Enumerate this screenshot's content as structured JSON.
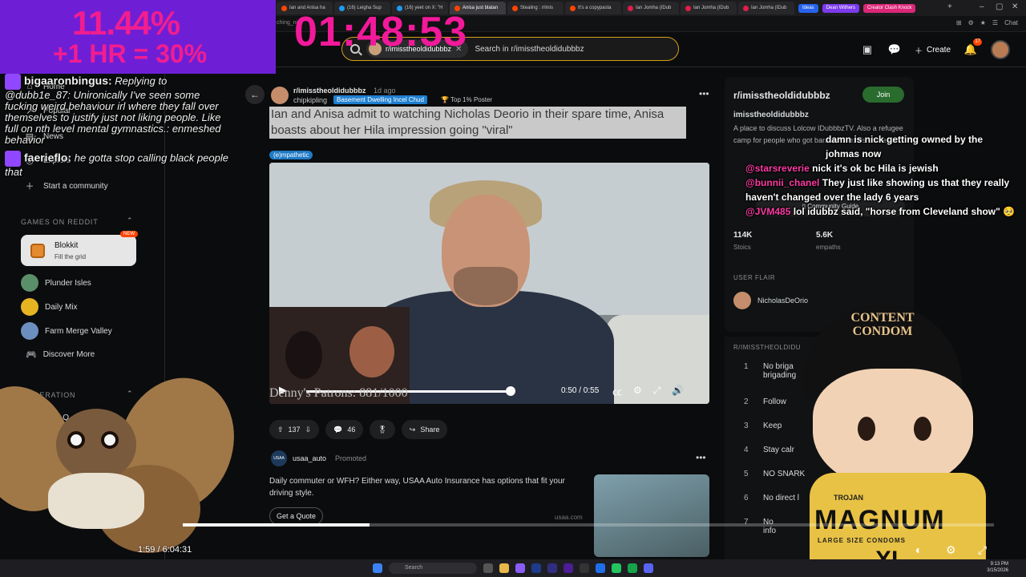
{
  "browser": {
    "tabs": [
      "Ian and Anisa ha",
      "(16) Leigha Sup",
      "(16) yeet on X: \"H",
      "Anisa just blatan",
      "Stealing : r/imis",
      "It's a copypasta",
      "Ian Jomha (IDub",
      "Ian Jomha (IDub",
      "Ian Jomha (IDub"
    ],
    "tab_pills": [
      "Ideas",
      "Dean Withers",
      "Creator Clash Knock"
    ],
    "address": "ching_ni",
    "colors": {
      "pill1": "#2563eb",
      "pill2": "#7c3aed",
      "pill3": "#db2777"
    }
  },
  "overlay": {
    "percent": "11.44%",
    "hr_text": "+1 HR = 30%",
    "timer": "01:48:53"
  },
  "header": {
    "search_chip": "r/imisstheoldidubbbz",
    "search_placeholder": "Search in r/imisstheoldidubbbz",
    "create_label": "Create",
    "notif_count": "17",
    "chat_label": "Chat"
  },
  "sidebar": {
    "nav": [
      {
        "label": "Home",
        "icon": "home-icon"
      },
      {
        "label": "Popular",
        "icon": "popular-icon"
      },
      {
        "label": "News",
        "icon": "news-icon"
      },
      {
        "label": "Explore",
        "icon": "explore-icon"
      },
      {
        "label": "Start a community",
        "icon": "plus-icon"
      }
    ],
    "games_title": "GAMES ON REDDIT",
    "blokkit": {
      "name": "Blokkit",
      "sub": "Fill the grid",
      "badge": "NEW"
    },
    "games": [
      {
        "label": "Plunder Isles",
        "color": "#5b8f6a"
      },
      {
        "label": "Daily Mix",
        "color": "#e6b422"
      },
      {
        "label": "Farm Merge Valley",
        "color": "#6b8fbf"
      },
      {
        "label": "Discover More",
        "color": ""
      }
    ],
    "moderation_title": "MODERATION",
    "mod_item": "Mod Q"
  },
  "chat_left": [
    {
      "user": "bigaaronbingus:",
      "text": "Replying to @dubb1e_87: Unironically I've seen some fucking weird behaviour irl where they fall over themselves to justify just not liking people. Like full on nth level mental gymnastics.: enmeshed behavior"
    },
    {
      "user": "faerieflo:",
      "text": "he gotta stop calling black people that"
    }
  ],
  "post": {
    "subreddit": "r/imisstheoldidubbbz",
    "time": "1d ago",
    "author": "chipkipling",
    "user_flair": "Basement Dwelling Incel Chud",
    "top_poster": "Top 1% Poster",
    "title": "Ian and Anisa admit to watching Nicholas Deorio in their spare time, Anisa boasts about her Hila impression going \"viral\"",
    "post_flair": "(e)mpathetic",
    "video_time": "0:50 / 0:55",
    "patrons": "Denny's Patrons: 881/1000",
    "progress": 0.91,
    "upvotes": "137",
    "comments": "46",
    "share_label": "Share"
  },
  "promo": {
    "name": "usaa_auto",
    "tag": "Promoted",
    "logo": "USAA",
    "text": "Daily commuter or WFH? Either way, USAA Auto Insurance has options that fit your driving style.",
    "button": "Get a Quote",
    "domain": "usaa.com"
  },
  "rsidebar": {
    "name": "r/imisstheoldidubbbz",
    "join": "Join",
    "title": "imisstheoldidubbbz",
    "desc": "A place to discuss Lolcow IDubbbzTV. Also a refugee camp for people who got banned from his subreddit.",
    "guide": "Community Guide",
    "members": "114K",
    "members_label": "Stoics",
    "online": "5.6K",
    "online_label": "empaths",
    "flair_title": "USER FLAIR",
    "flair_user": "NicholasDeOrio",
    "rules_title": "R/IMISSTHEOLDIDU",
    "rules": [
      {
        "n": "1",
        "t": "No briga",
        "t2": "brigading"
      },
      {
        "n": "2",
        "t": "Follow"
      },
      {
        "n": "3",
        "t": "Keep"
      },
      {
        "n": "4",
        "t": "Stay calr"
      },
      {
        "n": "5",
        "t": "NO SNARK"
      },
      {
        "n": "6",
        "t": "No direct l"
      },
      {
        "n": "7",
        "t": "No",
        "t2": "info"
      }
    ]
  },
  "chat_right": [
    {
      "user": "",
      "text": "damn is nick getting owned by the johmas now"
    },
    {
      "user": "@starsreverie",
      "text": "nick it's ok bc Hila is jewish"
    },
    {
      "user": "@bunnii_chanel",
      "text": "They just like showing us that they really haven't changed over the lady 6 years"
    },
    {
      "user": "@JVM485",
      "text": "lol idubbz said, \"horse from Cleveland show\" 🥺"
    }
  ],
  "mascot": {
    "cap_text": "CONTENT CONDOM",
    "shirt_top": "TROJAN",
    "shirt_main": "MAGNUM",
    "shirt_bottom": "LARGE SIZE CONDOMS",
    "shirt_xl": "XL"
  },
  "stream": {
    "time": "1:59 / 6:04:31",
    "progress": 0.23
  },
  "taskbar": {
    "search": "Search",
    "time": "9:13 PM",
    "date": "3/15/2026"
  }
}
